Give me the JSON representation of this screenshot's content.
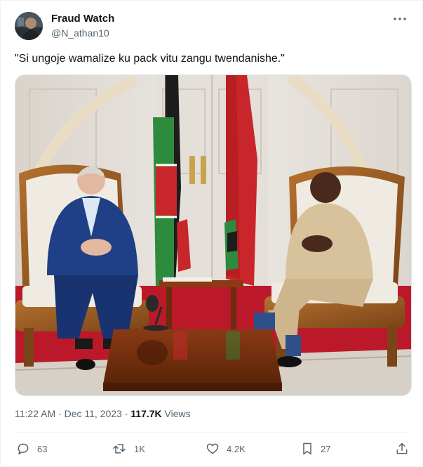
{
  "author": {
    "name": "Fraud Watch",
    "handle": "@N_athan10"
  },
  "tweet": {
    "text": "\"Si ungoje wamalize ku pack vitu zangu twendanishe.\""
  },
  "meta": {
    "time": "11:22 AM",
    "separator": "·",
    "date": "Dec 11, 2023",
    "views_count": "117.7K",
    "views_label": "Views"
  },
  "actions": {
    "replies": "63",
    "reposts": "1K",
    "likes": "4.2K",
    "bookmarks": "27"
  },
  "colors": {
    "text_primary": "#0f1419",
    "text_secondary": "#536471",
    "divider": "#eff3f4"
  },
  "icons": [
    "more-icon",
    "reply-icon",
    "repost-icon",
    "like-icon",
    "bookmark-icon",
    "share-icon"
  ]
}
